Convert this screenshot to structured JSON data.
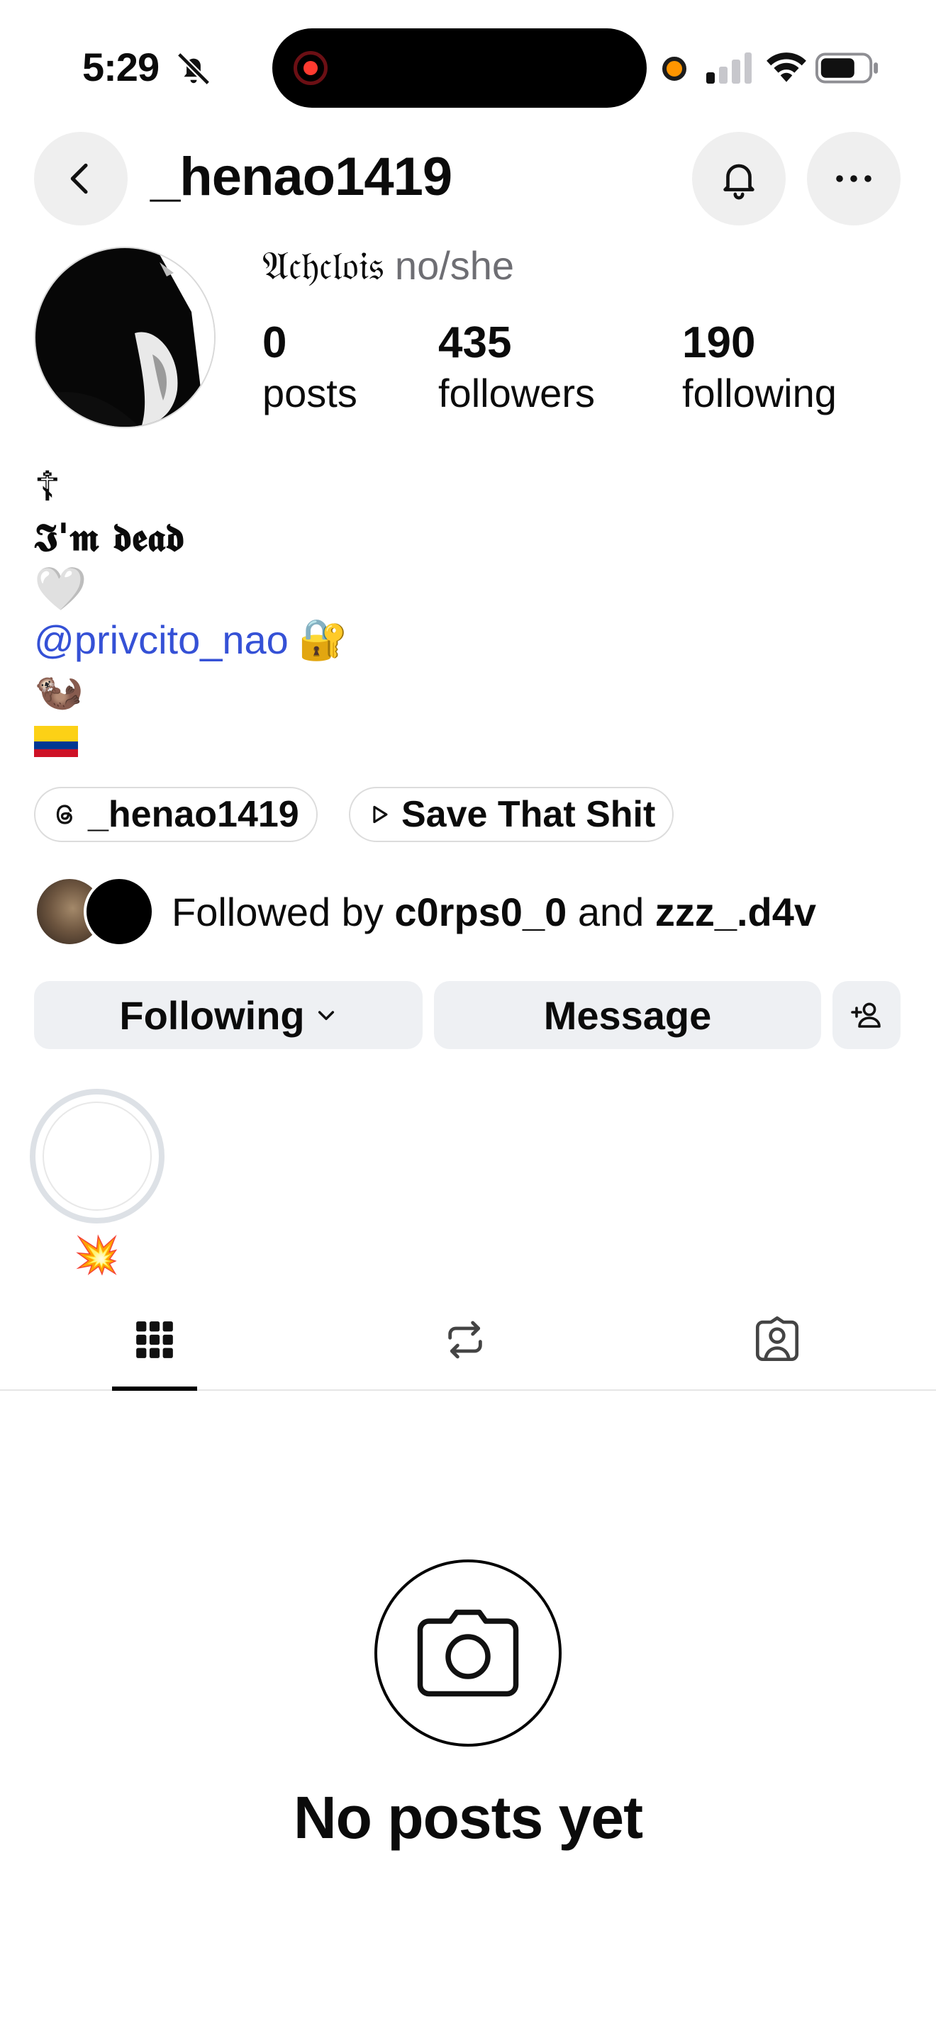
{
  "status_bar": {
    "time": "5:29"
  },
  "header": {
    "username": "_henao1419"
  },
  "profile": {
    "full_name": "𝔄𝔠𝔥𝔠𝔩𝔬𝔦𝔰",
    "pronouns": "no/she",
    "stats": [
      {
        "value": "0",
        "label": "posts"
      },
      {
        "value": "435",
        "label": "followers"
      },
      {
        "value": "190",
        "label": "following"
      }
    ]
  },
  "bio": {
    "line1": "☦",
    "line2": "𝕴'𝖒 𝖉𝖊𝖆𝖉",
    "line3": "🤍",
    "mention": "@privcito_nao",
    "mention_emoji": "🔐",
    "line5": "🦦",
    "line6_icon": "colombia-flag"
  },
  "chips": {
    "threads_label": "_henao1419",
    "link_label": "Save That Shit"
  },
  "followed_by": {
    "prefix": "Followed by",
    "user1": "c0rps0_0",
    "joiner": "and",
    "user2": "zzz_.d4v"
  },
  "actions": {
    "following_label": "Following",
    "message_label": "Message"
  },
  "highlights": [
    {
      "label": "💥"
    }
  ],
  "tabs": {
    "active": "grid",
    "items": [
      "grid-icon",
      "reposts-icon",
      "tagged-icon"
    ]
  },
  "empty_state": {
    "title": "No posts yet"
  },
  "colors": {
    "link": "#3551d6",
    "button_bg": "#eef0f3",
    "recording": "#ff3b30",
    "mic_indicator": "#ff9500"
  }
}
